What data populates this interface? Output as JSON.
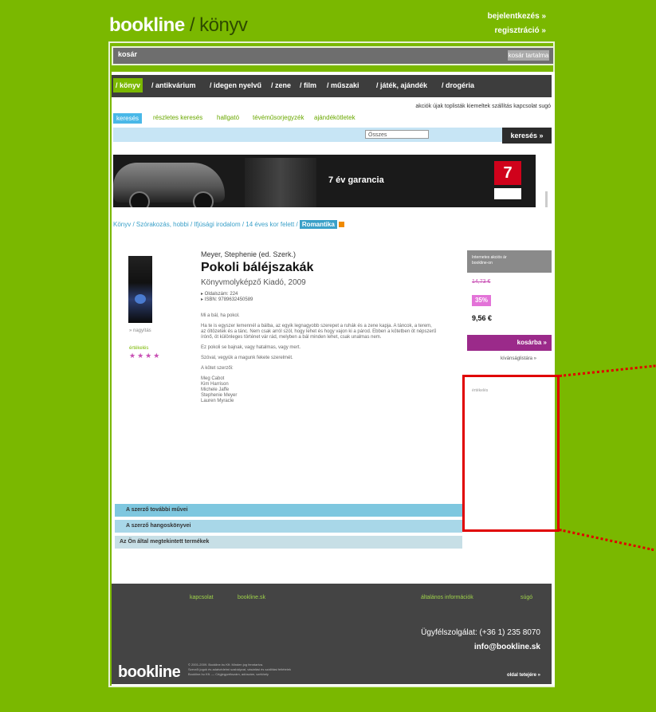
{
  "header": {
    "logo_main": "bookline",
    "logo_sub": " / könyv",
    "links": [
      "bejelentkezés »",
      "regisztráció »"
    ]
  },
  "login_bar": {
    "label": "kosár",
    "button": "kosár tartalma"
  },
  "nav": {
    "active": "/ könyv",
    "items": [
      "/ antikvárium",
      "/ idegen nyelvű",
      "/ zene",
      "/ film",
      "/ műszaki",
      "/ játék, ajándék",
      "/ drogéria"
    ]
  },
  "sublinks": "akciók újak toplisták kiemeltek szállítás kapcsolat sugó",
  "tabs": [
    "keresés",
    "részletes keresés",
    "hallgató",
    "tévéműsorjegyzék",
    "ajándékötletek"
  ],
  "search": {
    "category": "Összes",
    "button": "keresés »"
  },
  "banner": {
    "text": "7 év garancia",
    "badge": "7"
  },
  "breadcrumb": {
    "path": "Könyv / Szórakozás, hobbi / Ifjúsági irodalom / 14 éves kor felett /",
    "current": "Romantika"
  },
  "product": {
    "author": "Meyer, Stephenie (ed. Szerk.)",
    "title": "Pokoli báléjszakák",
    "publisher": "Könyvmolyképző Kiadó, 2009",
    "meta": [
      "▸ Oldalszám: 224",
      "▸ ISBN: 9789632450589"
    ],
    "enlarge": "» nagyítás",
    "rating_label": "értékelés",
    "stars": "★★★★",
    "description": [
      "Mi a bál, ha pokol.",
      "Ha te is egyszer lemennél a bálba, az egyik legnagyobb szerepet a ruhák és a zene kapja. A táncok, a terem, az öltözetek és a tánc. Nem csak arról szól, hogy lehet és hogy vajon ki a párod. Ebben a kötetben öt népszerű írónő, öt különleges történet vár rád, melyben a bál minden lehet, csak unalmas nem.",
      "Ez pokoli se bajnak, vagy hatalmas, vagy mert.",
      "Szóval, vegyük a magunk fekete szerelmét.",
      "A kötet szerzői:"
    ],
    "authors_list": [
      "Meg Cabot",
      "Kim Harrison",
      "Michele Jaffe",
      "Stephenie Meyer",
      "Lauren Myracle"
    ]
  },
  "price": {
    "box_label": "Internetes akciós ár bookline-on",
    "old": "14,73 €",
    "discount": "35%",
    "new": "9,56 €",
    "buy": "kosárba »",
    "wish": "kívánságlistára »",
    "sidebox_label": "értékelés"
  },
  "accordions": [
    "A szerző további művei",
    "A szerző hangoskönyvei",
    "Az Ön által megtekintett termékek"
  ],
  "footer": {
    "links_left": [
      "kapcsolat",
      "bookline.sk"
    ],
    "links_right": [
      "általános információk",
      "súgó"
    ],
    "phone": "Ügyfélszolgálat: (+36 1) 235 8070",
    "email": "info@bookline.sk",
    "logo": "bookline",
    "copyright": [
      "© 2001-2009. Bookline.hu Kft. Minden jog fenntartva.",
      "Szerzői jogok és adatvédelmi szabályzat, vásárlási és szállítási feltételek",
      "Bookline.hu Kft. — Cégjegyzékszám, adószám, székhely"
    ],
    "right_link": "oldal tetejére »"
  },
  "colors": {
    "background": "#7ab800",
    "nav": "#3d3d3d",
    "accent_purple": "#9b2a8a",
    "accent_blue": "#49b8e8",
    "annotation": "#e00000"
  }
}
